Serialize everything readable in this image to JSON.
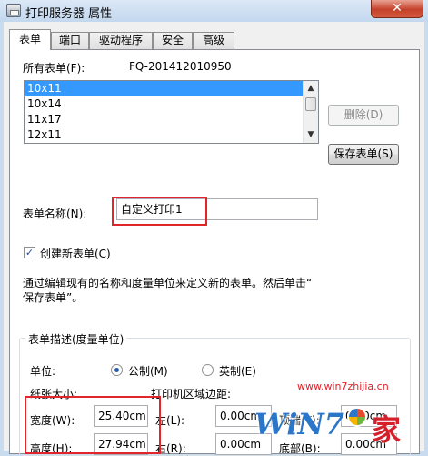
{
  "window": {
    "title": "打印服务器 属性",
    "close_label": "✕"
  },
  "tabs": [
    {
      "label": "表单",
      "active": true
    },
    {
      "label": "端口",
      "active": false
    },
    {
      "label": "驱动程序",
      "active": false
    },
    {
      "label": "安全",
      "active": false
    },
    {
      "label": "高级",
      "active": false
    }
  ],
  "forms": {
    "all_forms_label": "所有表单(F):",
    "machine_name": "FQ-201412010950",
    "list_items": [
      "10x11",
      "10x14",
      "11x17",
      "12x11"
    ],
    "selected_item": "10x11",
    "delete_button": "删除(D)",
    "save_button": "保存表单(S)"
  },
  "form_name": {
    "label": "表单名称(N):",
    "value": "自定义打印1"
  },
  "create_new": {
    "label": "创建新表单(C)",
    "checked": true
  },
  "description": {
    "line1": "通过编辑现有的名称和度量单位来定义新的表单。然后单击“",
    "line2": "保存表单”。"
  },
  "measurement": {
    "group_title": "表单描述(度量单位)",
    "unit_label": "单位:",
    "metric_label": "公制(M)",
    "english_label": "英制(E)",
    "selected_unit": "metric",
    "paper_size_label": "纸张大小:",
    "printer_margins_label": "打印机区域边距:",
    "width_label": "宽度(W):",
    "width_value": "25.40cm",
    "height_label": "高度(H):",
    "height_value": "27.94cm",
    "left_label": "左(L):",
    "left_value": "0.00cm",
    "right_label": "右(R):",
    "right_value": "0.00cm",
    "top_label": "顶端(T):",
    "top_value": "0.00cm",
    "bottom_label": "底部(B):",
    "bottom_value": "0.00cm"
  },
  "watermark": {
    "url": "www.win7zhijia.cn",
    "logo_win": "WiN7",
    "logo_jia": "家"
  },
  "colors": {
    "highlight": "#e0262a",
    "selection": "#3399ff",
    "title_bar": "#c3d7ee",
    "close": "#c4412b"
  }
}
